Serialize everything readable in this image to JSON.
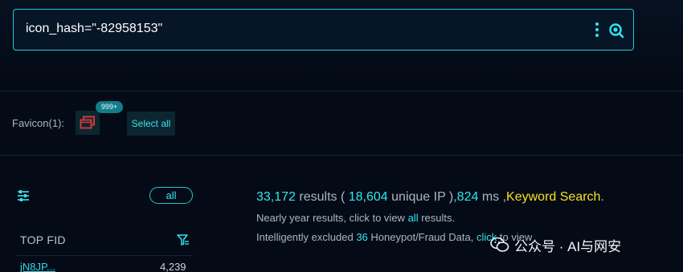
{
  "search": {
    "query": "icon_hash=\"-82958153\"",
    "more_icon": "kebab-menu-icon",
    "submit_icon": "search-icon"
  },
  "favicon": {
    "label": "Favicon(1):",
    "badge": "999+",
    "select_all": "Select all",
    "icon": "favicon-windows-icon",
    "icon_color": "#d0373a"
  },
  "sidebar": {
    "filter_icon": "sliders-icon",
    "all_label": "all",
    "top_fid_title": "TOP FID",
    "rows": [
      {
        "name": "jN8JP...",
        "count": "4,239"
      }
    ]
  },
  "results": {
    "total": "33,172",
    "results_word": "results (",
    "unique_ip": "18,604",
    "unique_ip_word": "unique IP )",
    "ms_value": ",824",
    "ms_word": "ms ,",
    "keyword_search": "Keyword Search",
    "period": ".",
    "line2_prefix": "Nearly year results, click to view",
    "line2_link": "all",
    "line2_suffix": "results.",
    "line3_prefix": "Intelligently excluded",
    "line3_count": "36",
    "line3_mid": "Honeypot/Fraud Data,",
    "line3_link": "click",
    "line3_suffix": "to view"
  },
  "watermark": {
    "text": "公众号 · AI与网安"
  },
  "colors": {
    "accent": "#2ee6f0",
    "keyword": "#f4e01f",
    "background": "#050b16"
  }
}
